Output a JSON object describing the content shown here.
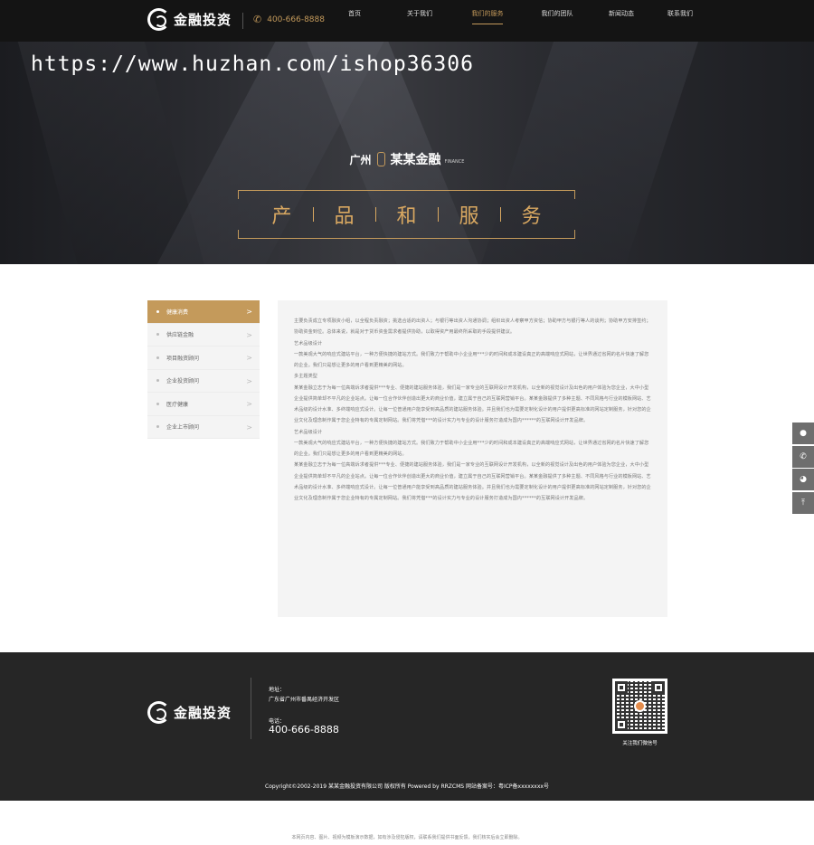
{
  "header": {
    "logo_text": "金融投资",
    "phone": "400-666-8888",
    "nav": [
      "首页",
      "关于我们",
      "我们的服务",
      "我们的团队",
      "新闻动态",
      "联系我们"
    ],
    "active_nav": "我们的服务"
  },
  "watermark": "https://www.huzhan.com/ishop36306",
  "banner": {
    "city": "广州",
    "brand": "某某金融",
    "brand_en": "FINANCE",
    "title_chars": [
      "产",
      "品",
      "和",
      "服",
      "务"
    ]
  },
  "sidebar": {
    "items": [
      {
        "label": "健康消费",
        "active": true
      },
      {
        "label": "供应链金融",
        "active": false
      },
      {
        "label": "项目融资顾问",
        "active": false
      },
      {
        "label": "企业投资顾问",
        "active": false
      },
      {
        "label": "医疗健康",
        "active": false
      },
      {
        "label": "企业上市顾问",
        "active": false
      }
    ]
  },
  "content": {
    "paragraphs": [
      "主要负责成立专项融资小组，以全程负责融资；挑选合适的出资人；与银行等出资人沟通协调；组织出资人考察甲方资信；协助甲方与银行等人的谈判；协助甲方安排签约；协助资金到位。总体来说，就是对于货币资金需求者提供协助，以取得资产用最终所采取的手段提供建议。",
      "艺术品级设计",
      "一款美观大气的响应式建站平台，一种方便快捷的建站方式。我们致力于帮助中小企业用***少的时间和成本建设真正的高端响应式网站，让世界通过省网的名片快速了解您的企业。我们只是想让更多的用户看到更精美的网站。",
      "多主题类型",
      "某某金融立志于为每一位高端诉求者提供***专业、便捷的建站服务体验，我们是一家专业的互联网设计开发机构，以全新的视觉设计及出色的用户体验为您企业，大中小型企业提供简单却不平凡的企业站点。让每一位合作伙伴创造出更大的商业价值，建立属于自己的互联网营销平台。某某金融提供了多种主题、不同风格与行业的模板网站、艺术品级的设计水准、多终端响应式设计。让每一位普通用户能享受到高品质的建站服务体验。并且我们也为需要定制化设计的用户提供更高标准的网站定制服务，针对您的企业文化及理念制作属于您企业特有的专属定制网站。我们将凭借***的设计实力与专业的设计服务打造成为国内******的互联网设计开发品牌。",
      "艺术品级设计",
      "一款美观大气的响应式建站平台，一种方便快捷的建站方式。我们致力于帮助中小企业用***少的时间和成本建设真正的高端响应式网站，让世界通过省网的名片快速了解您的企业。我们只是想让更多的用户看到更精美的网站。",
      "某某金融立志于为每一位高端诉求者提供***专业、便捷的建站服务体验，我们是一家专业的互联网设计开发机构，以全新的视觉设计及出色的用户体验为您企业，大中小型企业提供简单却不平凡的企业站点。让每一位合作伙伴创造出更大的商业价值，建立属于自己的互联网营销平台。某某金融提供了多种主题、不同风格与行业的模板网站、艺术品级的设计水准、多终端响应式设计。让每一位普通用户能享受到高品质的建站服务体验。并且我们也为需要定制化设计的用户提供更高标准的网站定制服务，针对您的企业文化及理念制作属于您企业特有的专属定制网站。我们将凭借***的设计实力与专业的设计服务打造成为国内******的互联网设计开发品牌。"
    ]
  },
  "floating": {
    "icons": [
      "qq-icon",
      "phone-icon",
      "wechat-icon",
      "back-to-top-icon"
    ]
  },
  "footer": {
    "logo_text": "金融投资",
    "address_label": "地址：",
    "address": "广东省广州市番禺经济开发区",
    "tel_label": "电话：",
    "tel": "400-666-8888",
    "qr_caption": "关注我们微信号",
    "copyright": "Copyright©2002-2019 某某金融投资有限公司 版权所有 Powered by RRZCMS 网站备案号：粤ICP备xxxxxxxx号"
  },
  "disclaimer": "本网页内容、图片、视频为模板演示数据，如有涉及侵犯版权，请联系我们提供书面反馈，我们核实后会立即删除。"
}
